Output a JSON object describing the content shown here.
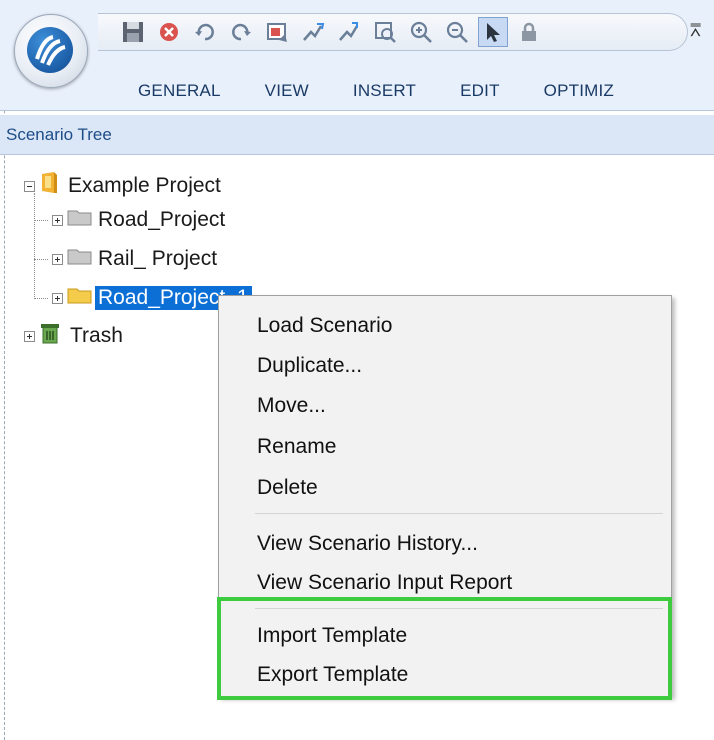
{
  "ribbon": {
    "tabs": [
      "GENERAL",
      "VIEW",
      "INSERT",
      "EDIT",
      "OPTIMIZ"
    ],
    "qat_icons": [
      "save-icon",
      "stop-icon",
      "undo-icon",
      "redo-icon",
      "screenshot-icon",
      "connect-in-icon",
      "connect-out-icon",
      "zoom-extents-icon",
      "zoom-in-icon",
      "zoom-out-icon",
      "select-pointer-icon",
      "lock-icon"
    ]
  },
  "pane": {
    "title": "Scenario Tree"
  },
  "tree": {
    "root": "Example Project",
    "children": [
      "Road_Project",
      "Rail_ Project",
      "Road_Project_1"
    ],
    "trash": "Trash"
  },
  "context_menu": {
    "items": [
      "Load Scenario",
      "Duplicate...",
      "Move...",
      "Rename",
      "Delete",
      "View Scenario History...",
      "View Scenario Input Report",
      "Import Template",
      "Export Template"
    ]
  },
  "colors": {
    "selection": "#0b6fd6",
    "highlight": "#3fcb3f",
    "tab_text": "#1a3a66"
  }
}
